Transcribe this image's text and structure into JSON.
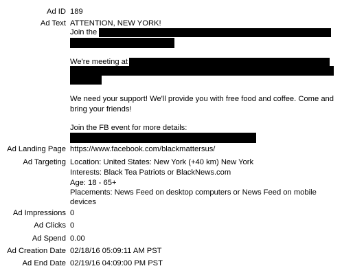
{
  "labels": {
    "ad_id": "Ad ID",
    "ad_text": "Ad Text",
    "landing_page": "Ad Landing Page",
    "targeting": "Ad Targeting",
    "impressions": "Ad Impressions",
    "clicks": "Ad Clicks",
    "spend": "Ad Spend",
    "creation_date": "Ad Creation Date",
    "end_date": "Ad End Date"
  },
  "values": {
    "ad_id": "189",
    "ad_text": {
      "line1": "ATTENTION, NEW YORK!",
      "join_prefix": "Join the",
      "meeting_prefix": "We're meeting at",
      "support_line1": "We need your support! We'll provide you with free food and coffee. Come and",
      "support_line2": "bring your friends!",
      "event_line": "Join the FB event for more details:"
    },
    "landing_page": "https://www.facebook.com/blackmattersus/",
    "targeting": {
      "location": "Location: United States: New York (+40 km) New York",
      "interests": "Interests: Black Tea Patriots or BlackNews.com",
      "age": "Age: 18 - 65+",
      "placements_line1": "Placements: News Feed on desktop computers or News Feed on mobile",
      "placements_line2": "devices"
    },
    "impressions": "0",
    "clicks": "0",
    "spend": "0.00",
    "creation_date": "02/18/16 05:09:11 AM PST",
    "end_date": "02/19/16 04:09:00 PM PST"
  }
}
